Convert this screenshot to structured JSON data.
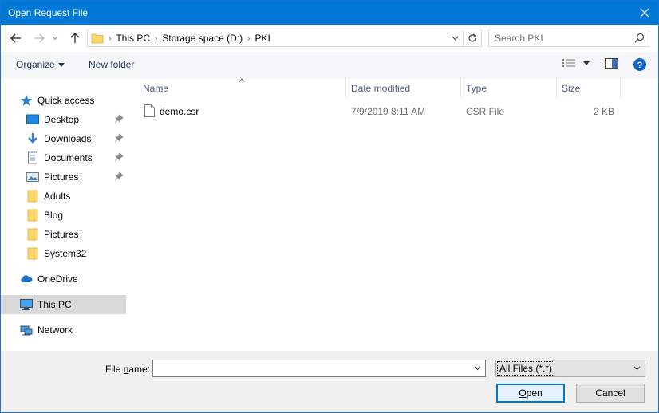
{
  "window": {
    "title": "Open Request File"
  },
  "address": {
    "crumbs": [
      "This PC",
      "Storage space (D:)",
      "PKI"
    ]
  },
  "search": {
    "placeholder": "Search PKI"
  },
  "toolbar": {
    "organize_label": "Organize",
    "new_folder_label": "New folder"
  },
  "sidebar": {
    "items": [
      {
        "label": "Quick access"
      },
      {
        "label": "Desktop"
      },
      {
        "label": "Downloads"
      },
      {
        "label": "Documents"
      },
      {
        "label": "Pictures"
      },
      {
        "label": "Adults"
      },
      {
        "label": "Blog"
      },
      {
        "label": "Pictures"
      },
      {
        "label": "System32"
      },
      {
        "label": "OneDrive"
      },
      {
        "label": "This PC"
      },
      {
        "label": "Network"
      }
    ]
  },
  "columns": {
    "name": "Name",
    "date": "Date modified",
    "type": "Type",
    "size": "Size"
  },
  "files": [
    {
      "name": "demo.csr",
      "date": "7/9/2019 8:11 AM",
      "type": "CSR File",
      "size": "2 KB"
    }
  ],
  "bottom": {
    "filename_label_pre": "File ",
    "filename_label_key": "n",
    "filename_label_post": "ame:",
    "filename_value": "",
    "filter_value": "All Files (*.*)",
    "open_key": "O",
    "open_rest": "pen",
    "cancel_label": "Cancel"
  }
}
